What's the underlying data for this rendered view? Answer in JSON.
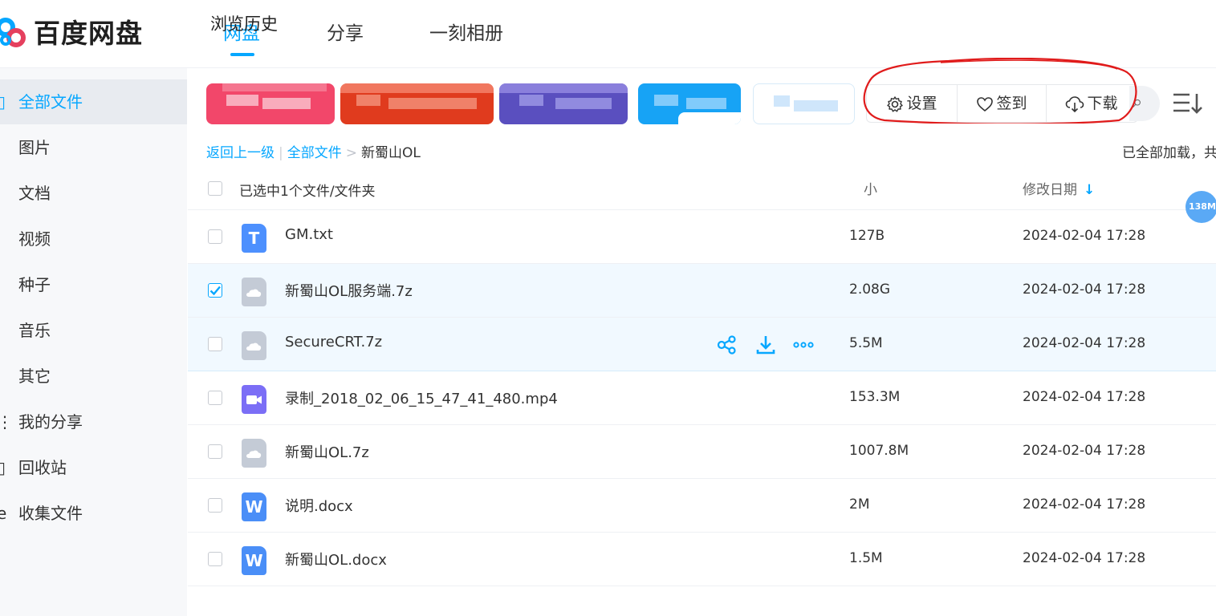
{
  "app": {
    "name": "百度网盘"
  },
  "nav": {
    "tabs": [
      {
        "label": "网盘",
        "active": true
      },
      {
        "label": "分享",
        "active": false
      },
      {
        "label": "一刻相册",
        "active": false
      }
    ],
    "history_label": "浏览历史"
  },
  "sidebar": {
    "items": [
      {
        "label": "全部文件",
        "active": true
      },
      {
        "label": "图片"
      },
      {
        "label": "文档"
      },
      {
        "label": "视频"
      },
      {
        "label": "种子"
      },
      {
        "label": "音乐"
      },
      {
        "label": "其它"
      },
      {
        "label": "我的分享"
      },
      {
        "label": "回收站"
      },
      {
        "label": "收集文件"
      }
    ]
  },
  "toolbar": {
    "settings_label": "设置",
    "signin_label": "签到",
    "download_label": "下载"
  },
  "breadcrumb": {
    "back": "返回上一级",
    "root": "全部文件",
    "current": "新蜀山OL"
  },
  "load_status": "已全部加载，共",
  "list": {
    "selection_label": "已选中1个文件/文件夹",
    "size_header": "小",
    "date_header": "修改日期",
    "float_badge": "138M",
    "rows": [
      {
        "name": "GM.txt",
        "size": "127B",
        "date": "2024-02-04 17:28",
        "type": "txt",
        "icon": "txt-file-icon",
        "selected": false
      },
      {
        "name": "新蜀山OL服务端.7z",
        "size": "2.08G",
        "date": "2024-02-04 17:28",
        "type": "archive",
        "icon": "archive-file-icon",
        "selected": true
      },
      {
        "name": "SecureCRT.7z",
        "size": "5.5M",
        "date": "2024-02-04 17:28",
        "type": "archive",
        "icon": "archive-file-icon",
        "selected": false
      },
      {
        "name": "录制_2018_02_06_15_47_41_480.mp4",
        "size": "153.3M",
        "date": "2024-02-04 17:28",
        "type": "video",
        "icon": "video-file-icon",
        "selected": false
      },
      {
        "name": "新蜀山OL.7z",
        "size": "1007.8M",
        "date": "2024-02-04 17:28",
        "type": "archive",
        "icon": "archive-file-icon",
        "selected": false
      },
      {
        "name": "说明.docx",
        "size": "2M",
        "date": "2024-02-04 17:28",
        "type": "word",
        "icon": "word-file-icon",
        "selected": false
      },
      {
        "name": "新蜀山OL.docx",
        "size": "1.5M",
        "date": "2024-02-04 17:28",
        "type": "word",
        "icon": "word-file-icon",
        "selected": false
      }
    ]
  },
  "colors": {
    "accent": "#06a7ff",
    "txt_icon": "#4d90fe",
    "archive_icon": "#c4cbd6",
    "video_icon": "#7b6ef6",
    "word_icon": "#4a8ef7",
    "annotation": "#e01b1b"
  }
}
